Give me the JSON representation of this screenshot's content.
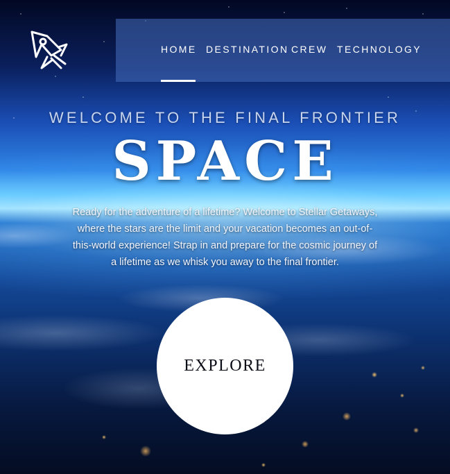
{
  "header": {
    "logo_icon": "rocket-logo-icon"
  },
  "nav": {
    "items": [
      {
        "label": "HOME",
        "active": true
      },
      {
        "label": "DESTINATION",
        "active": false
      },
      {
        "label": "CREW",
        "active": false
      },
      {
        "label": "TECHNOLOGY",
        "active": false
      }
    ]
  },
  "hero": {
    "subtitle": "WELCOME TO THE FINAL FRONTIER",
    "title": "SPACE",
    "body": "Ready for the adventure of a lifetime? Welcome to Stellar Getaways, where the stars are the limit and your vacation becomes an out-of-this-world experience! Strap in and prepare for the cosmic journey of a lifetime as we whisk you away to the final frontier.",
    "cta_label": "EXPLORE"
  },
  "colors": {
    "nav_background": "#466ebe",
    "text": "#ffffff",
    "cta_background": "#ffffff",
    "cta_text": "#0b0d17"
  }
}
